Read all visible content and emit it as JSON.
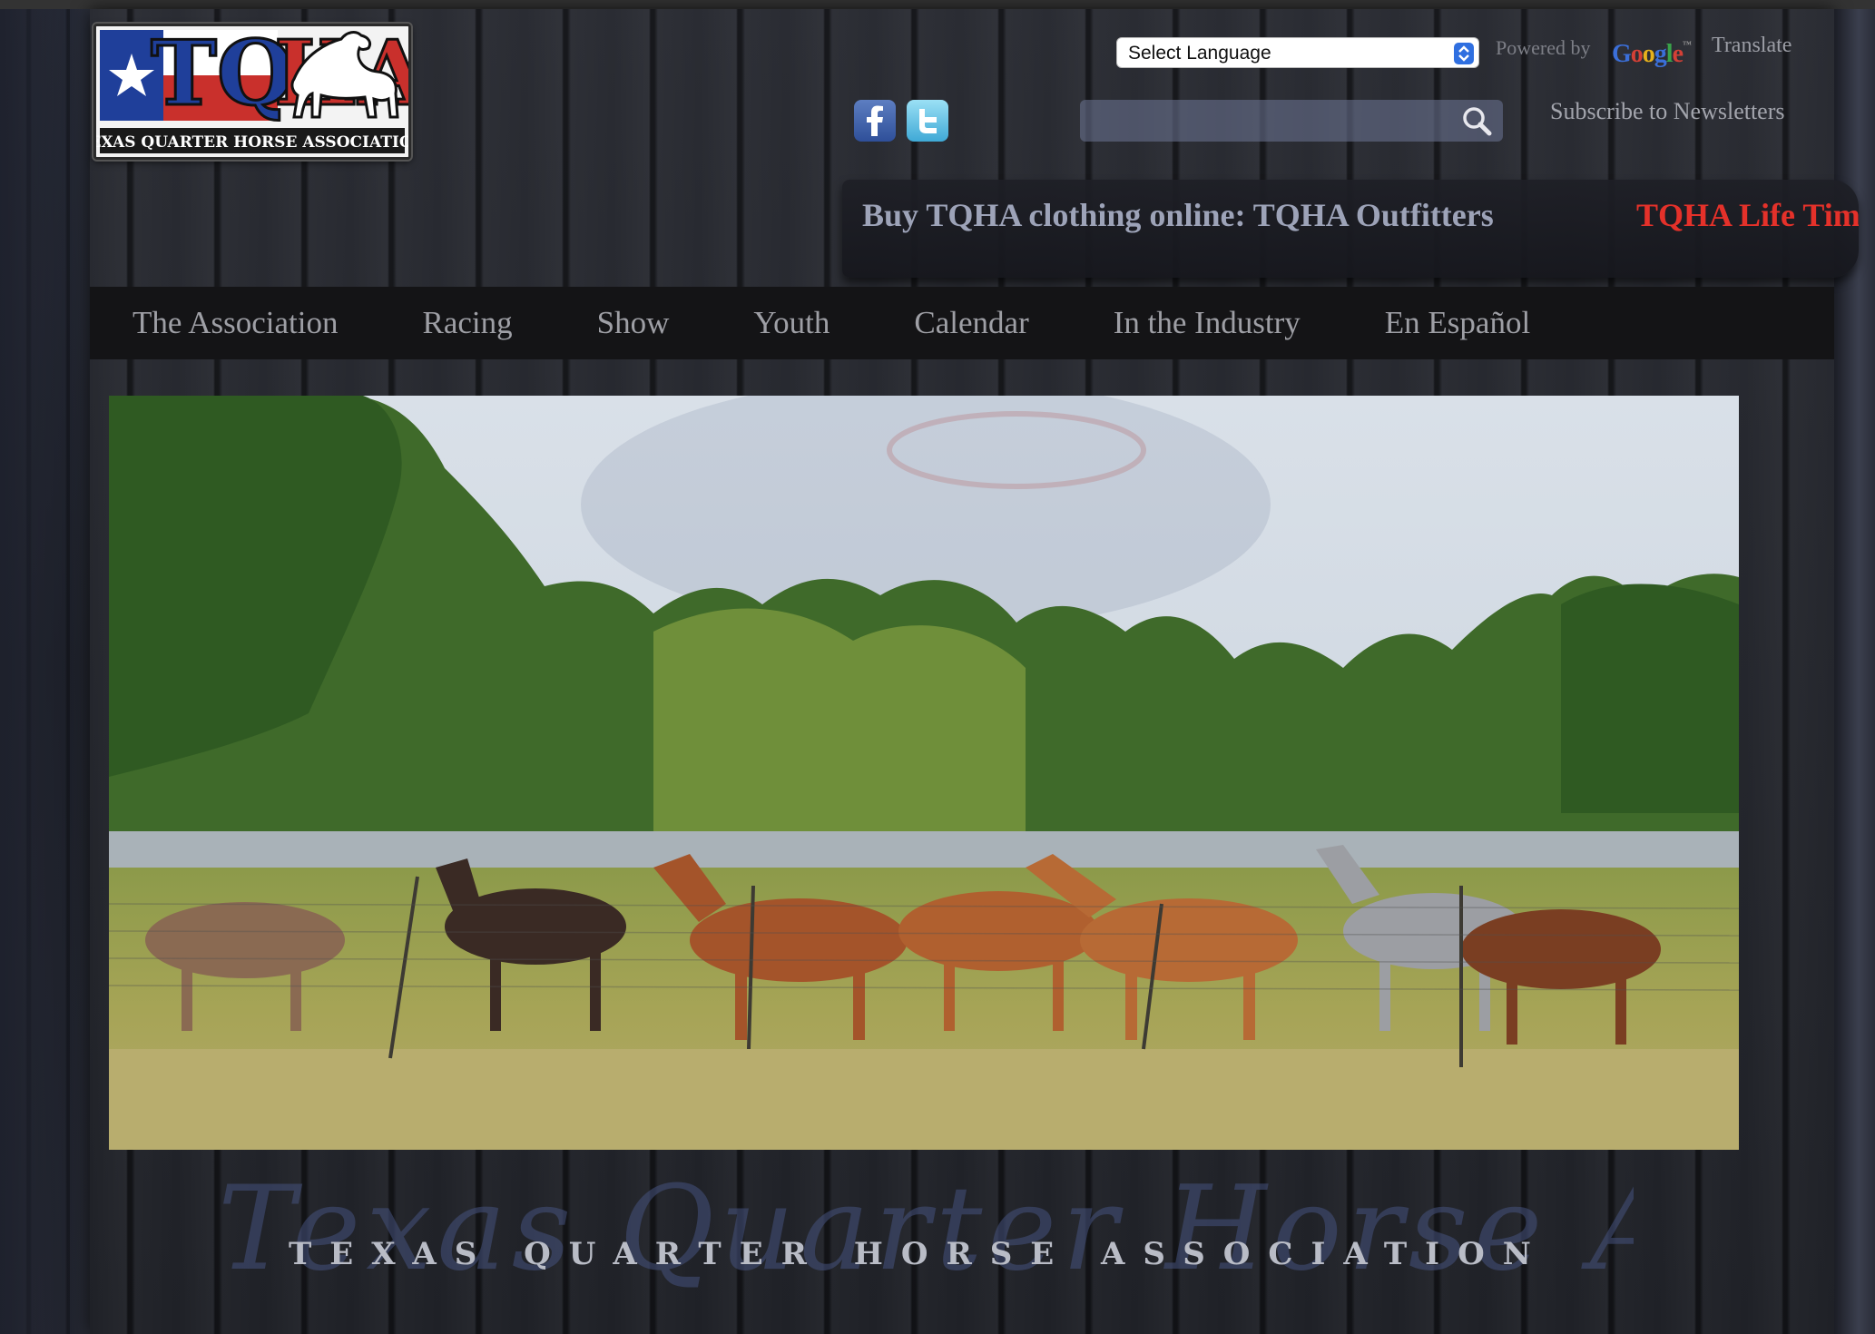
{
  "header": {
    "logo_text": "TQHA",
    "logo_subtitle": "TEXAS QUARTER HORSE ASSOCIATION",
    "language_select": "Select Language",
    "powered_by": "Powered by",
    "google_brand": "Google",
    "translate_label": "Translate",
    "search": {
      "placeholder": "",
      "value": ""
    },
    "subscribe_label": "Subscribe to Newsletters",
    "social": [
      "facebook",
      "twitter"
    ]
  },
  "ticker": {
    "item1": "Buy TQHA clothing online: TQHA Outfitters",
    "item2": "TQHA Life Time"
  },
  "nav": {
    "items": [
      "The Association",
      "Racing",
      "Show",
      "Youth",
      "Calendar",
      "In the Industry",
      "En Español"
    ]
  },
  "footer": {
    "script_text": "Texas Quarter Horse Association",
    "caps_text": "TEXAS QUARTER HORSE ASSOCIATION"
  },
  "colors": {
    "accent_red": "#e4312a",
    "nav_bg": "#141416",
    "nav_text": "#9e9fa5",
    "ticker_text": "#9da3b8"
  }
}
